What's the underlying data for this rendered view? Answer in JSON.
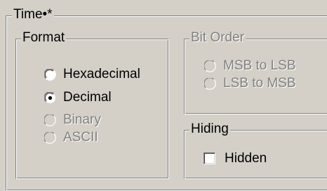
{
  "time_group": {
    "title": "Time•*"
  },
  "format_group": {
    "title": "Format",
    "options": [
      {
        "label": "Hexadecimal",
        "selected": false,
        "enabled": true
      },
      {
        "label": "Decimal",
        "selected": true,
        "enabled": true
      },
      {
        "label": "Binary",
        "selected": false,
        "enabled": false
      },
      {
        "label": "ASCII",
        "selected": false,
        "enabled": false
      }
    ]
  },
  "bit_order_group": {
    "title": "Bit Order",
    "enabled": false,
    "options": [
      {
        "label": "MSB to LSB",
        "selected": false,
        "enabled": false
      },
      {
        "label": "LSB to MSB",
        "selected": false,
        "enabled": false
      }
    ]
  },
  "hiding_group": {
    "title": "Hiding",
    "hidden_checkbox": {
      "label": "Hidden",
      "checked": false
    }
  },
  "colors": {
    "face": "#d4d0c8",
    "shadow": "#808080",
    "highlight": "#ffffff"
  }
}
